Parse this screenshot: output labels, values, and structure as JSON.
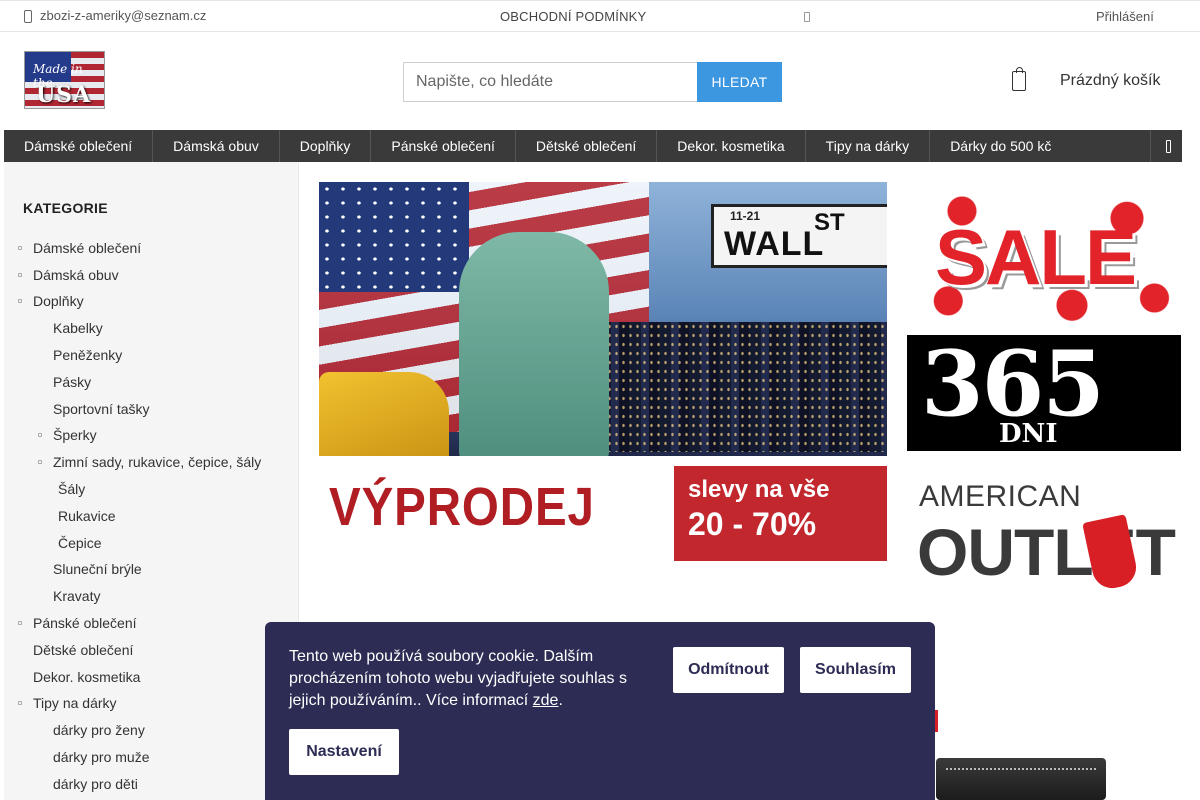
{
  "topbar": {
    "email": "zbozi-z-ameriky@seznam.cz",
    "terms": "OBCHODNÍ PODMÍNKY",
    "login": "Přihlášení"
  },
  "logo": {
    "line1": "Made in the",
    "line2": "USA"
  },
  "search": {
    "placeholder": "Napište, co hledáte",
    "button": "HLEDAT"
  },
  "cart": {
    "label": "Prázdný košík"
  },
  "nav": [
    "Dámské oblečení",
    "Dámská obuv",
    "Doplňky",
    "Pánské oblečení",
    "Dětské oblečení",
    "Dekor. kosmetika",
    "Tipy na dárky",
    "Dárky do 500 kč"
  ],
  "sidebar": {
    "heading": "KATEGORIE",
    "items": [
      {
        "label": "Dámské oblečení",
        "bullet": true
      },
      {
        "label": "Dámská obuv",
        "bullet": true
      },
      {
        "label": "Doplňky",
        "bullet": true
      },
      {
        "label": "Kabelky",
        "bullet": false
      },
      {
        "label": "Peněženky",
        "bullet": false
      },
      {
        "label": "Pásky",
        "bullet": false
      },
      {
        "label": "Sportovní tašky",
        "bullet": false
      },
      {
        "label": "Šperky",
        "bullet": true
      },
      {
        "label": "Zimní sady, rukavice, čepice, šály",
        "bullet": true
      },
      {
        "label": "Šály",
        "bullet": false
      },
      {
        "label": "Rukavice",
        "bullet": false
      },
      {
        "label": "Čepice",
        "bullet": false
      },
      {
        "label": "Sluneční brýle",
        "bullet": false
      },
      {
        "label": "Kravaty",
        "bullet": false
      },
      {
        "label": "Pánské oblečení",
        "bullet": true
      },
      {
        "label": "Dětské oblečení",
        "bullet": false
      },
      {
        "label": "Dekor. kosmetika",
        "bullet": false
      },
      {
        "label": "Tipy na dárky",
        "bullet": true
      },
      {
        "label": "dárky pro ženy",
        "bullet": false
      },
      {
        "label": "dárky pro muže",
        "bullet": false
      },
      {
        "label": "dárky pro děti",
        "bullet": false
      }
    ]
  },
  "hero": {
    "street_number": "11-21",
    "street_name": "WALL",
    "street_suffix": "ST",
    "headline": "VÝPRODEJ",
    "sub": "slevy na vše",
    "percent": "20 - 70%"
  },
  "side_banners": {
    "sale": "SALE",
    "days_number": "365",
    "days_label": "DNI",
    "outlet_top": "AMERICAN",
    "outlet_bottom": "OUTLET"
  },
  "cookie": {
    "message": "Tento web používá soubory cookie. Dalším procházením tohoto webu vyjadřujete souhlas s jejich používáním.. Více informací ",
    "link": "zde",
    "decline": "Odmítnout",
    "accept": "Souhlasím",
    "settings": "Nastavení"
  },
  "colors": {
    "nav_bg": "#3a3a3a",
    "search_button": "#3c96e0",
    "cookie_bg": "#2c2c54",
    "sale_red": "#e2232a"
  },
  "icons": {
    "email": "phone-icon",
    "top_middle": "info-icon",
    "cart": "shopping-bag-icon",
    "nav_more": "menu-more-icon"
  }
}
